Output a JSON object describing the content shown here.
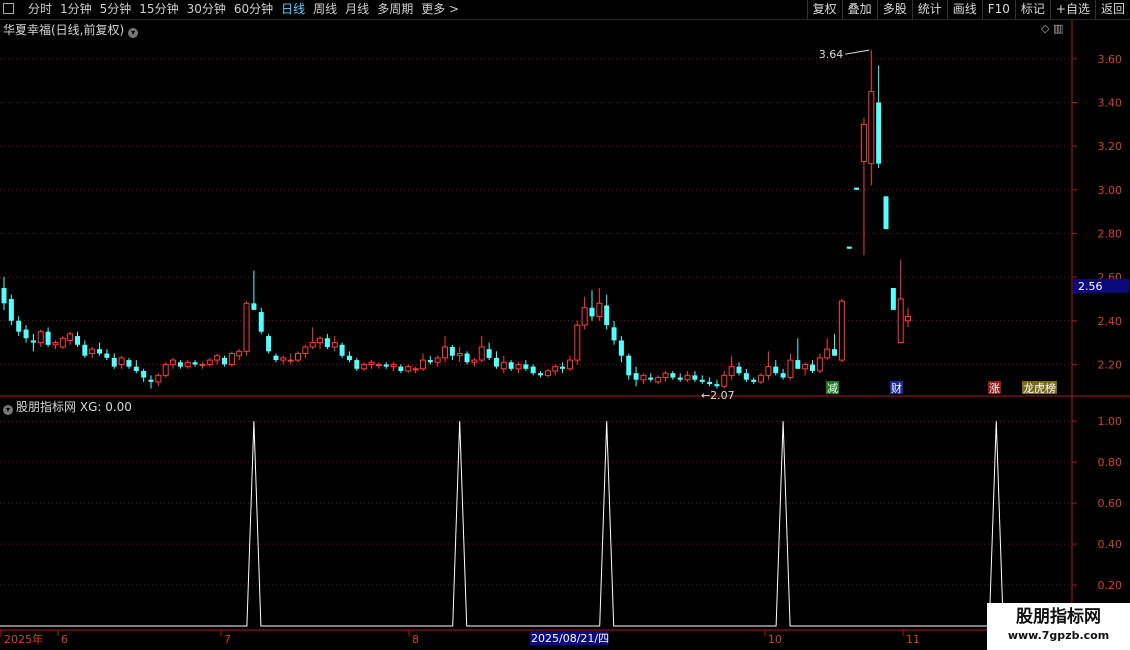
{
  "toolbar": {
    "periods": [
      "分时",
      "1分钟",
      "5分钟",
      "15分钟",
      "30分钟",
      "60分钟",
      "日线",
      "周线",
      "月线",
      "多周期",
      "更多 >"
    ],
    "active_period": "日线",
    "right_menu": [
      "复权",
      "叠加",
      "多股",
      "统计",
      "画线",
      "F10",
      "标记",
      "+自选",
      "返回"
    ]
  },
  "price_panel": {
    "title": "华夏幸福(日线,前复权)",
    "high_marker": "3.64",
    "low_marker": "2.07",
    "current_price": "2.56",
    "event_tags": [
      "减",
      "财",
      "涨",
      "龙虎榜"
    ]
  },
  "indicator_panel": {
    "title": "股朋指标网",
    "value_label": "XG: 0.00"
  },
  "date_axis": {
    "labels": [
      "2025年",
      "6",
      "7",
      "8",
      "2025/08/21/四",
      "10",
      "11"
    ]
  },
  "watermark": {
    "title": "股朋指标网",
    "url": "www.7gpzb.com"
  },
  "colors": {
    "up": "#ff3b3b",
    "down": "#54ffff",
    "axis": "#b01818",
    "grid": "#7a1a1a",
    "active_tab": "#5fd0ff"
  },
  "chart_data": [
    {
      "type": "candlestick",
      "name": "price",
      "y_ticks": [
        2.2,
        2.4,
        2.6,
        2.8,
        3.0,
        3.2,
        3.4,
        3.6
      ],
      "ylim": [
        2.06,
        3.7
      ],
      "candles": [
        [
          2.55,
          2.6,
          2.45,
          2.48
        ],
        [
          2.5,
          2.52,
          2.38,
          2.4
        ],
        [
          2.4,
          2.42,
          2.33,
          2.35
        ],
        [
          2.36,
          2.38,
          2.3,
          2.32
        ],
        [
          2.31,
          2.34,
          2.26,
          2.3
        ],
        [
          2.3,
          2.36,
          2.28,
          2.35
        ],
        [
          2.35,
          2.37,
          2.28,
          2.29
        ],
        [
          2.29,
          2.31,
          2.27,
          2.3
        ],
        [
          2.28,
          2.33,
          2.27,
          2.32
        ],
        [
          2.31,
          2.35,
          2.29,
          2.34
        ],
        [
          2.33,
          2.35,
          2.28,
          2.29
        ],
        [
          2.29,
          2.31,
          2.23,
          2.24
        ],
        [
          2.25,
          2.28,
          2.23,
          2.27
        ],
        [
          2.27,
          2.3,
          2.24,
          2.25
        ],
        [
          2.25,
          2.27,
          2.22,
          2.23
        ],
        [
          2.23,
          2.25,
          2.18,
          2.19
        ],
        [
          2.2,
          2.24,
          2.18,
          2.23
        ],
        [
          2.22,
          2.23,
          2.18,
          2.19
        ],
        [
          2.19,
          2.22,
          2.16,
          2.17
        ],
        [
          2.17,
          2.18,
          2.12,
          2.14
        ],
        [
          2.13,
          2.15,
          2.09,
          2.12
        ],
        [
          2.12,
          2.16,
          2.1,
          2.15
        ],
        [
          2.15,
          2.21,
          2.14,
          2.2
        ],
        [
          2.2,
          2.23,
          2.18,
          2.22
        ],
        [
          2.21,
          2.22,
          2.18,
          2.19
        ],
        [
          2.19,
          2.22,
          2.18,
          2.21
        ],
        [
          2.21,
          2.22,
          2.19,
          2.2
        ],
        [
          2.2,
          2.21,
          2.18,
          2.2
        ],
        [
          2.2,
          2.23,
          2.19,
          2.22
        ],
        [
          2.22,
          2.25,
          2.2,
          2.24
        ],
        [
          2.23,
          2.24,
          2.19,
          2.2
        ],
        [
          2.2,
          2.26,
          2.19,
          2.25
        ],
        [
          2.24,
          2.27,
          2.22,
          2.26
        ],
        [
          2.26,
          2.49,
          2.24,
          2.48
        ],
        [
          2.48,
          2.63,
          2.45,
          2.45
        ],
        [
          2.44,
          2.46,
          2.34,
          2.35
        ],
        [
          2.33,
          2.34,
          2.25,
          2.26
        ],
        [
          2.24,
          2.25,
          2.21,
          2.22
        ],
        [
          2.22,
          2.24,
          2.2,
          2.23
        ],
        [
          2.22,
          2.25,
          2.2,
          2.22
        ],
        [
          2.22,
          2.26,
          2.21,
          2.25
        ],
        [
          2.25,
          2.29,
          2.23,
          2.28
        ],
        [
          2.28,
          2.37,
          2.27,
          2.3
        ],
        [
          2.3,
          2.33,
          2.27,
          2.32
        ],
        [
          2.32,
          2.34,
          2.27,
          2.28
        ],
        [
          2.28,
          2.33,
          2.26,
          2.3
        ],
        [
          2.29,
          2.3,
          2.23,
          2.24
        ],
        [
          2.24,
          2.26,
          2.21,
          2.22
        ],
        [
          2.22,
          2.23,
          2.17,
          2.18
        ],
        [
          2.18,
          2.21,
          2.17,
          2.2
        ],
        [
          2.2,
          2.22,
          2.18,
          2.21
        ],
        [
          2.2,
          2.21,
          2.18,
          2.2
        ],
        [
          2.2,
          2.21,
          2.18,
          2.19
        ],
        [
          2.19,
          2.21,
          2.17,
          2.2
        ],
        [
          2.19,
          2.2,
          2.16,
          2.17
        ],
        [
          2.17,
          2.2,
          2.16,
          2.19
        ],
        [
          2.18,
          2.19,
          2.16,
          2.18
        ],
        [
          2.18,
          2.25,
          2.17,
          2.22
        ],
        [
          2.22,
          2.24,
          2.2,
          2.21
        ],
        [
          2.21,
          2.24,
          2.19,
          2.23
        ],
        [
          2.23,
          2.33,
          2.21,
          2.28
        ],
        [
          2.28,
          2.29,
          2.22,
          2.24
        ],
        [
          2.24,
          2.28,
          2.21,
          2.25
        ],
        [
          2.25,
          2.26,
          2.2,
          2.21
        ],
        [
          2.21,
          2.23,
          2.19,
          2.22
        ],
        [
          2.22,
          2.33,
          2.21,
          2.28
        ],
        [
          2.27,
          2.3,
          2.22,
          2.23
        ],
        [
          2.23,
          2.26,
          2.18,
          2.19
        ],
        [
          2.18,
          2.24,
          2.16,
          2.21
        ],
        [
          2.21,
          2.22,
          2.17,
          2.18
        ],
        [
          2.18,
          2.21,
          2.16,
          2.2
        ],
        [
          2.2,
          2.22,
          2.17,
          2.18
        ],
        [
          2.19,
          2.2,
          2.15,
          2.16
        ],
        [
          2.16,
          2.17,
          2.14,
          2.15
        ],
        [
          2.15,
          2.18,
          2.14,
          2.17
        ],
        [
          2.17,
          2.2,
          2.15,
          2.19
        ],
        [
          2.19,
          2.21,
          2.16,
          2.18
        ],
        [
          2.18,
          2.24,
          2.17,
          2.22
        ],
        [
          2.22,
          2.4,
          2.2,
          2.38
        ],
        [
          2.38,
          2.51,
          2.36,
          2.46
        ],
        [
          2.46,
          2.54,
          2.4,
          2.42
        ],
        [
          2.42,
          2.55,
          2.4,
          2.48
        ],
        [
          2.47,
          2.52,
          2.36,
          2.38
        ],
        [
          2.37,
          2.4,
          2.29,
          2.31
        ],
        [
          2.31,
          2.33,
          2.21,
          2.24
        ],
        [
          2.24,
          2.25,
          2.13,
          2.15
        ],
        [
          2.16,
          2.19,
          2.1,
          2.13
        ],
        [
          2.13,
          2.16,
          2.11,
          2.15
        ],
        [
          2.14,
          2.16,
          2.12,
          2.13
        ],
        [
          2.12,
          2.15,
          2.11,
          2.14
        ],
        [
          2.14,
          2.17,
          2.12,
          2.16
        ],
        [
          2.16,
          2.17,
          2.13,
          2.14
        ],
        [
          2.14,
          2.16,
          2.12,
          2.13
        ],
        [
          2.13,
          2.17,
          2.12,
          2.15
        ],
        [
          2.15,
          2.17,
          2.12,
          2.13
        ],
        [
          2.13,
          2.15,
          2.11,
          2.12
        ],
        [
          2.12,
          2.14,
          2.1,
          2.11
        ],
        [
          2.11,
          2.13,
          2.09,
          2.1
        ],
        [
          2.1,
          2.17,
          2.09,
          2.15
        ],
        [
          2.15,
          2.24,
          2.13,
          2.19
        ],
        [
          2.19,
          2.21,
          2.15,
          2.16
        ],
        [
          2.16,
          2.18,
          2.12,
          2.13
        ],
        [
          2.13,
          2.14,
          2.11,
          2.12
        ],
        [
          2.12,
          2.16,
          2.11,
          2.15
        ],
        [
          2.15,
          2.26,
          2.13,
          2.19
        ],
        [
          2.19,
          2.22,
          2.15,
          2.16
        ],
        [
          2.16,
          2.18,
          2.13,
          2.14
        ],
        [
          2.14,
          2.25,
          2.13,
          2.22
        ],
        [
          2.22,
          2.32,
          2.2,
          2.18
        ],
        [
          2.18,
          2.21,
          2.15,
          2.2
        ],
        [
          2.2,
          2.22,
          2.16,
          2.17
        ],
        [
          2.17,
          2.25,
          2.16,
          2.23
        ],
        [
          2.23,
          2.32,
          2.22,
          2.27
        ],
        [
          2.27,
          2.34,
          2.24,
          2.24
        ],
        [
          2.22,
          2.5,
          2.21,
          2.49
        ],
        [
          2.74,
          2.74,
          2.73,
          2.73
        ],
        [
          3.01,
          3.01,
          3.0,
          3.0
        ],
        [
          3.13,
          3.33,
          2.7,
          3.3
        ],
        [
          3.12,
          3.64,
          3.02,
          3.45
        ],
        [
          3.4,
          3.57,
          3.1,
          3.12
        ],
        [
          2.97,
          2.97,
          2.82,
          2.82
        ],
        [
          2.55,
          2.55,
          2.45,
          2.45
        ],
        [
          2.3,
          2.68,
          2.3,
          2.5
        ],
        [
          2.4,
          2.46,
          2.37,
          2.42
        ]
      ]
    },
    {
      "type": "line",
      "name": "XG",
      "y_ticks": [
        0.2,
        0.4,
        0.6,
        0.8,
        1.0
      ],
      "ylim": [
        0,
        1.04
      ],
      "spikes_at_candle_index": [
        34,
        62,
        82,
        106,
        135
      ],
      "values_base": 0,
      "spike_value": 1
    }
  ]
}
